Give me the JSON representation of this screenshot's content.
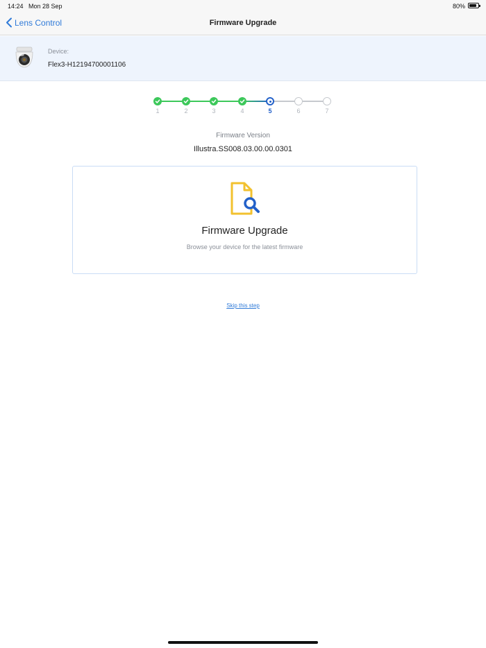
{
  "status": {
    "time": "14:24",
    "date": "Mon 28 Sep",
    "battery": "80%"
  },
  "nav": {
    "back_label": "Lens Control",
    "title": "Firmware Upgrade"
  },
  "device": {
    "label": "Device:",
    "id": "Flex3-H12194700001106"
  },
  "stepper": {
    "current_step": 5,
    "steps": [
      {
        "num": "1",
        "state": "done"
      },
      {
        "num": "2",
        "state": "done"
      },
      {
        "num": "3",
        "state": "done"
      },
      {
        "num": "4",
        "state": "done"
      },
      {
        "num": "5",
        "state": "current"
      },
      {
        "num": "6",
        "state": "todo"
      },
      {
        "num": "7",
        "state": "todo"
      }
    ]
  },
  "firmware": {
    "label": "Firmware Version",
    "version": "Illustra.SS008.03.00.00.0301"
  },
  "card": {
    "title": "Firmware Upgrade",
    "subtitle": "Browse your device for the latest firmware",
    "icon": "file-search-icon"
  },
  "skip_label": "Skip this step",
  "colors": {
    "accent": "#2f7ad8",
    "done": "#3cc85a",
    "current": "#2361c9",
    "file_icon": "#f2c12e"
  }
}
